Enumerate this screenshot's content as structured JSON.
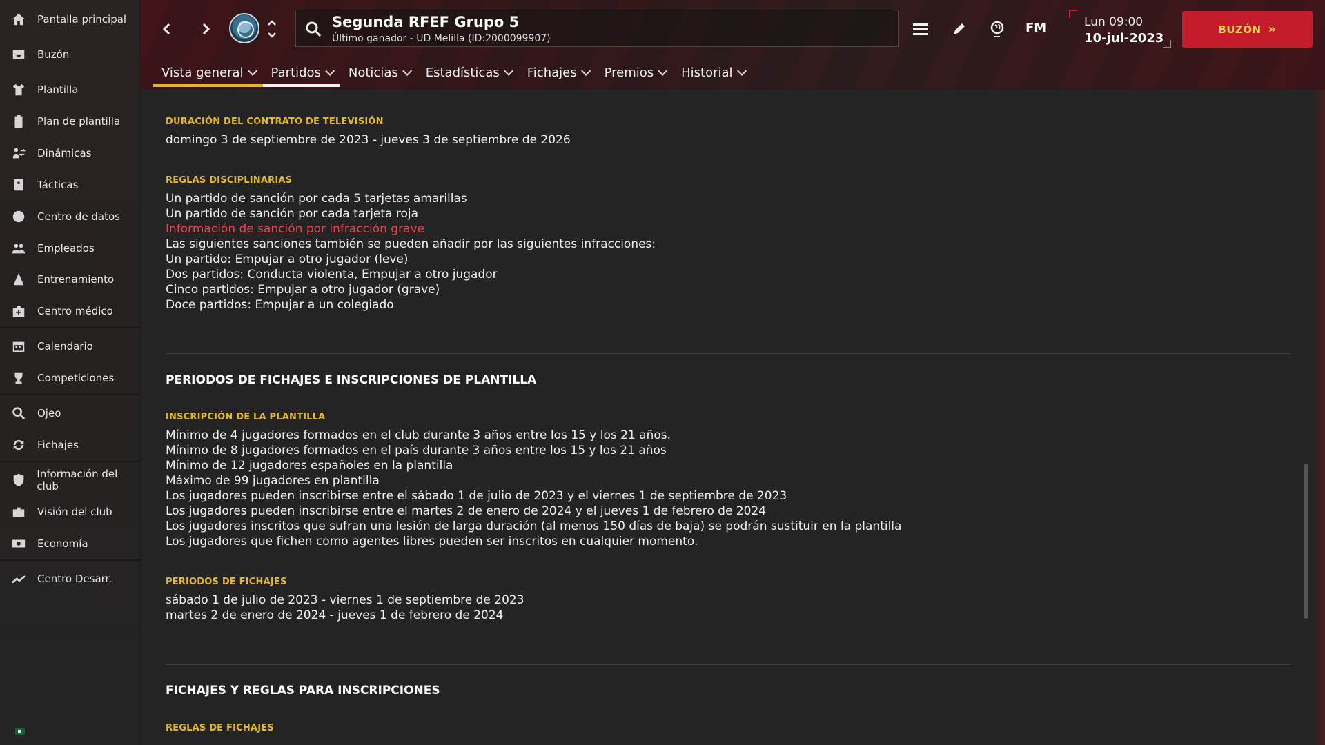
{
  "sidebar": {
    "items": [
      {
        "label": "Pantalla principal",
        "icon": "home-icon"
      },
      {
        "label": "Buzón",
        "icon": "inbox-icon"
      },
      {
        "label": "Plantilla",
        "icon": "shirt-icon"
      },
      {
        "label": "Plan de plantilla",
        "icon": "clipboard-icon"
      },
      {
        "label": "Dinámicas",
        "icon": "dynamics-icon"
      },
      {
        "label": "Tácticas",
        "icon": "tactics-board-icon"
      },
      {
        "label": "Centro de datos",
        "icon": "data-center-icon"
      },
      {
        "label": "Empleados",
        "icon": "staff-icon"
      },
      {
        "label": "Entrenamiento",
        "icon": "training-cone-icon"
      },
      {
        "label": "Centro médico",
        "icon": "medical-kit-icon"
      },
      {
        "label": "Calendario",
        "icon": "calendar-icon"
      },
      {
        "label": "Competiciones",
        "icon": "trophy-icon"
      },
      {
        "label": "Ojeo",
        "icon": "search-icon"
      },
      {
        "label": "Fichajes",
        "icon": "transfer-arrows-icon"
      },
      {
        "label": "Información del club",
        "icon": "shield-icon"
      },
      {
        "label": "Visión del club",
        "icon": "briefcase-icon"
      },
      {
        "label": "Economía",
        "icon": "money-icon"
      },
      {
        "label": "Centro Desarr.",
        "icon": "development-graph-icon"
      }
    ]
  },
  "header": {
    "competition_title": "Segunda RFEF Grupo 5",
    "competition_subtitle": "Último ganador - UD Melilla (ID:2000099907)",
    "time": "Lun 09:00",
    "date": "10-jul-2023",
    "inbox_button": "BUZÓN",
    "fm_logo": "FM"
  },
  "tabs": [
    {
      "label": "Vista general"
    },
    {
      "label": "Partidos"
    },
    {
      "label": "Noticias"
    },
    {
      "label": "Estadísticas"
    },
    {
      "label": "Fichajes"
    },
    {
      "label": "Premios"
    },
    {
      "label": "Historial"
    }
  ],
  "content": {
    "tv": {
      "heading": "DURACIÓN DEL CONTRATO DE TELEVISIÓN",
      "text": "domingo 3 de septiembre de 2023 - jueves 3 de septiembre de 2026"
    },
    "discipline": {
      "heading": "REGLAS DISCIPLINARIAS",
      "lines": [
        "Un partido de sanción por cada 5 tarjetas amarillas",
        "Un partido de sanción por cada tarjeta roja",
        "Información de sanción por infracción grave",
        "Las siguientes sanciones también se pueden añadir por las siguientes infracciones:",
        "Un partido: Empujar a otro jugador (leve)",
        "Dos partidos: Conducta violenta, Empujar a otro jugador",
        "Cinco partidos: Empujar a otro jugador (grave)",
        "Doce partidos: Empujar a un colegiado"
      ]
    },
    "registration_section": {
      "title": "PERIODOS DE FICHAJES E INSCRIPCIONES DE PLANTILLA",
      "squad_heading": "INSCRIPCIÓN DE LA PLANTILLA",
      "squad_lines": [
        "Mínimo de 4 jugadores formados en el club durante 3 años entre los 15 y los 21 años.",
        "Mínimo de 8 jugadores formados en el país durante 3 años entre los 15 y los 21 años",
        "Mínimo de 12 jugadores españoles en la plantilla",
        "Máximo de 99 jugadores en plantilla",
        "Los jugadores pueden inscribirse entre el sábado 1 de julio de 2023 y el viernes 1 de septiembre de 2023",
        "Los jugadores pueden inscribirse entre el martes 2 de enero de 2024 y el jueves 1 de febrero de 2024",
        "Los jugadores inscritos que sufran una lesión de larga duración (al menos 150 días de baja) se podrán sustituir en la plantilla",
        "Los jugadores que fichen como agentes libres pueden ser inscritos en cualquier momento."
      ],
      "windows_heading": "PERIODOS DE FICHAJES",
      "windows_lines": [
        "sábado 1 de julio de 2023 - viernes 1 de septiembre de 2023",
        "martes 2 de enero de 2024 - jueves 1 de febrero de 2024"
      ]
    },
    "transfer_rules_section": {
      "title": "FICHAJES Y REGLAS PARA INSCRIPCIONES",
      "partial_heading": "REGLAS DE FICHAJES"
    }
  },
  "colors": {
    "accent_yellow": "#e5b829",
    "accent_red": "#c41c2c",
    "link_red": "#e8434c"
  }
}
